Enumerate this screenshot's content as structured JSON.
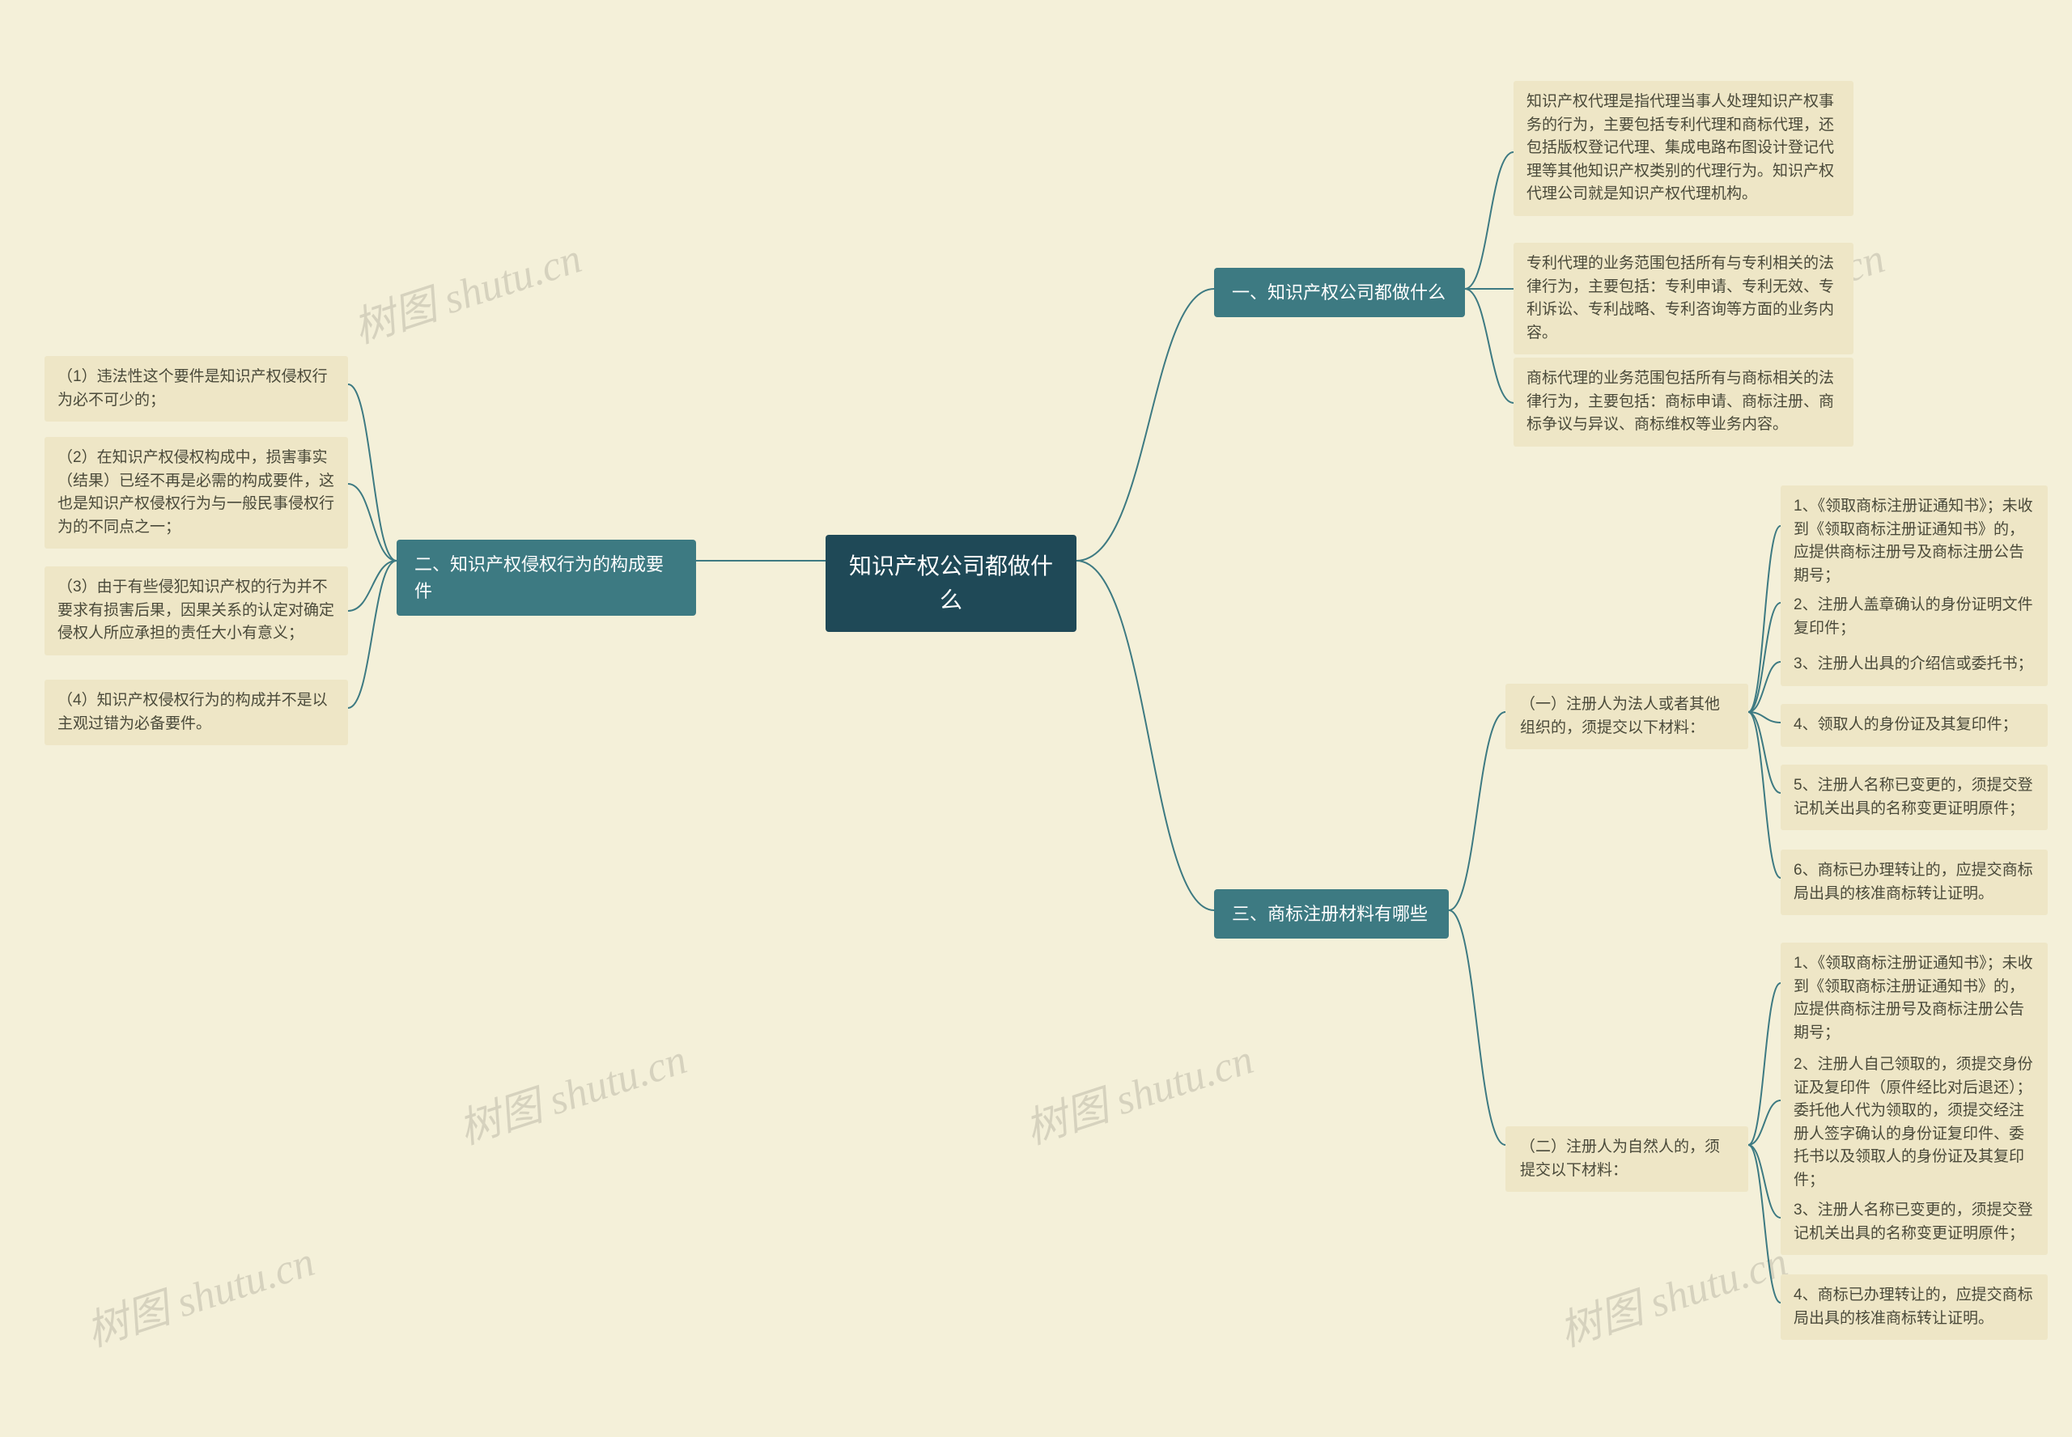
{
  "watermark": "树图 shutu.cn",
  "colors": {
    "bg": "#f4f0d9",
    "root": "#1f4957",
    "branch": "#3d7a82",
    "leaf": "#eee6c6",
    "connector": "#3d7a82"
  },
  "root": {
    "text": "知识产权公司都做什么"
  },
  "branch1": {
    "title": "一、知识产权公司都做什么",
    "items": [
      "知识产权代理是指代理当事人处理知识产权事务的行为，主要包括专利代理和商标代理，还包括版权登记代理、集成电路布图设计登记代理等其他知识产权类别的代理行为。知识产权代理公司就是知识产权代理机构。",
      "专利代理的业务范围包括所有与专利相关的法律行为，主要包括：专利申请、专利无效、专利诉讼、专利战略、专利咨询等方面的业务内容。",
      "商标代理的业务范围包括所有与商标相关的法律行为，主要包括：商标申请、商标注册、商标争议与异议、商标维权等业务内容。"
    ]
  },
  "branch2": {
    "title": "二、知识产权侵权行为的构成要件",
    "items": [
      "（1）违法性这个要件是知识产权侵权行为必不可少的；",
      "（2）在知识产权侵权构成中，损害事实（结果）已经不再是必需的构成要件，这也是知识产权侵权行为与一般民事侵权行为的不同点之一；",
      "（3）由于有些侵犯知识产权的行为并不要求有损害后果，因果关系的认定对确定侵权人所应承担的责任大小有意义；",
      "（4）知识产权侵权行为的构成并不是以主观过错为必备要件。"
    ]
  },
  "branch3": {
    "title": "三、商标注册材料有哪些",
    "subA": {
      "title": "（一）注册人为法人或者其他组织的，须提交以下材料：",
      "items": [
        "1、《领取商标注册证通知书》；未收到《领取商标注册证通知书》的，应提供商标注册号及商标注册公告期号；",
        "2、注册人盖章确认的身份证明文件复印件；",
        "3、注册人出具的介绍信或委托书；",
        "4、领取人的身份证及其复印件；",
        "5、注册人名称已变更的，须提交登记机关出具的名称变更证明原件；",
        "6、商标已办理转让的，应提交商标局出具的核准商标转让证明。"
      ]
    },
    "subB": {
      "title": "（二）注册人为自然人的，须提交以下材料：",
      "items": [
        "1、《领取商标注册证通知书》；未收到《领取商标注册证通知书》的，应提供商标注册号及商标注册公告期号；",
        "2、注册人自己领取的，须提交身份证及复印件（原件经比对后退还）；委托他人代为领取的，须提交经注册人签字确认的身份证复印件、委托书以及领取人的身份证及其复印件；",
        "3、注册人名称已变更的，须提交登记机关出具的名称变更证明原件；",
        "4、商标已办理转让的，应提交商标局出具的核准商标转让证明。"
      ]
    }
  }
}
